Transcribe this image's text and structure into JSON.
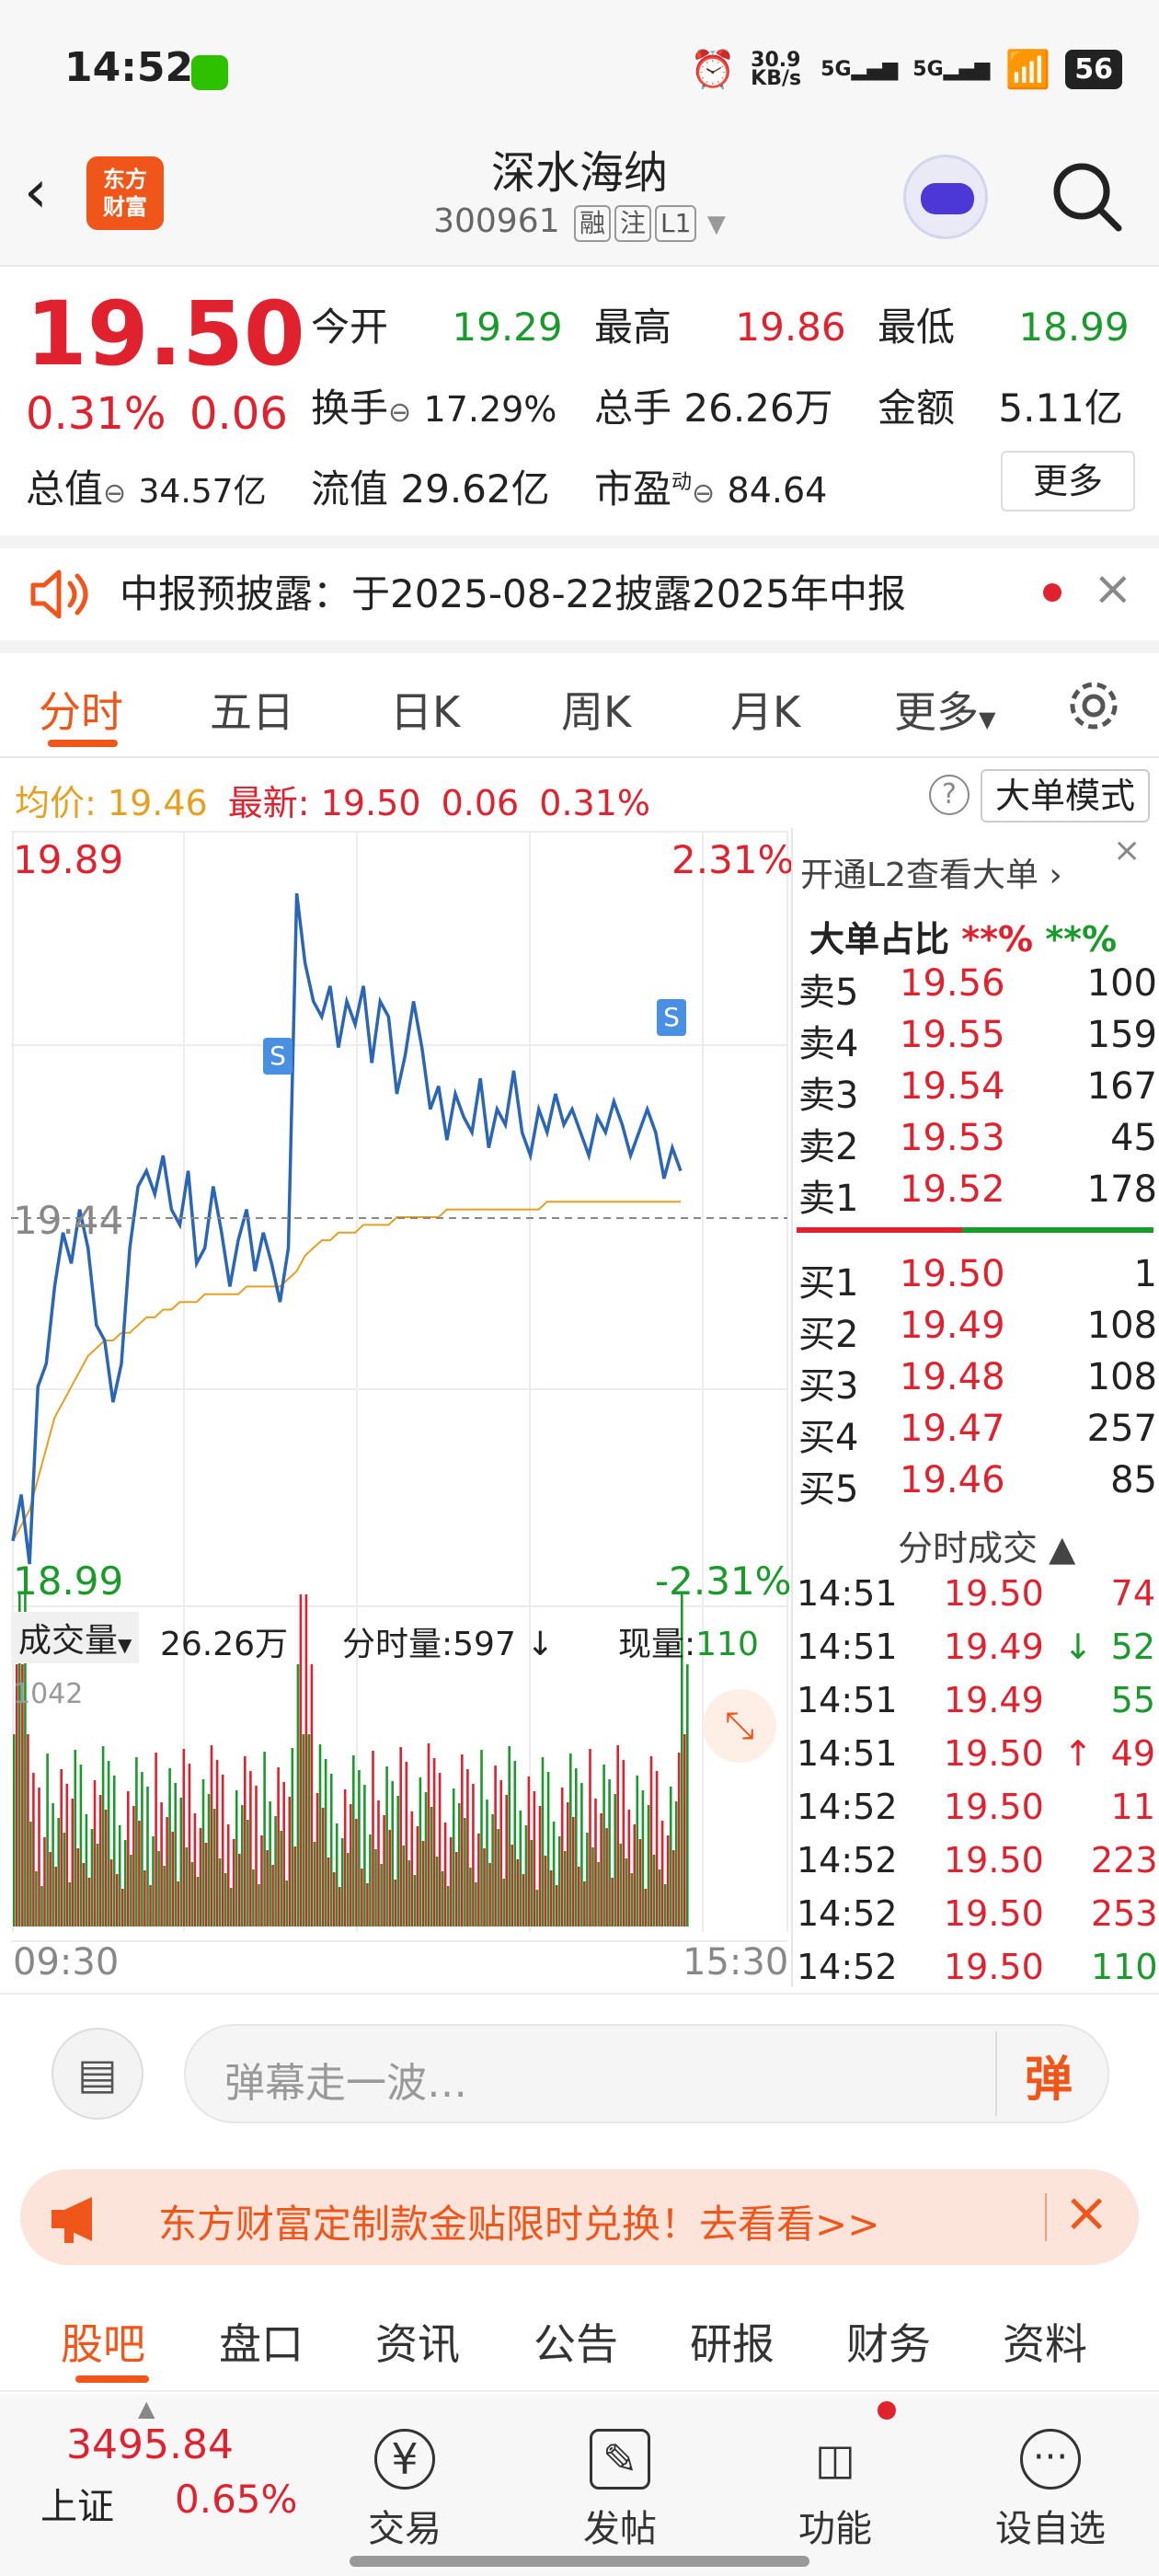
{
  "status": {
    "time": "14:52",
    "net_speed": "30.9 KB/s",
    "sig1": "5G",
    "sig2": "5G",
    "battery": "56"
  },
  "header": {
    "title": "深水海纳",
    "code": "300961",
    "tags": [
      "融",
      "注",
      "L1"
    ],
    "logo_line1": "东方",
    "logo_line2": "财富"
  },
  "quote": {
    "price": "19.50",
    "pct": "0.31%",
    "chg": "0.06",
    "open_label": "今开",
    "open": "19.29",
    "high_label": "最高",
    "high": "19.86",
    "low_label": "最低",
    "low": "18.99",
    "turnover_label": "换手",
    "turnover": "17.29%",
    "volume_label": "总手",
    "volume": "26.26万",
    "amount_label": "金额",
    "amount": "5.11亿",
    "mktcap_label": "总值",
    "mktcap": "34.57亿",
    "float_label": "流值",
    "float": "29.62亿",
    "pe_label": "市盈",
    "pe_sup": "动",
    "pe": "84.64",
    "more": "更多"
  },
  "notice": {
    "text": "中报预披露：于2025-08-22披露2025年中报"
  },
  "tabs": [
    "分时",
    "五日",
    "日K",
    "周K",
    "月K",
    "更多"
  ],
  "info": {
    "avg_label": "均价:",
    "avg": "19.46",
    "last_label": "最新:",
    "last": "19.50",
    "chg": "0.06",
    "pct": "0.31%",
    "mode": "大单模式"
  },
  "chart_data": {
    "type": "line",
    "y_top": "19.89",
    "y_bottom": "18.99",
    "y_mid": "19.44",
    "pct_top": "2.31%",
    "pct_bottom": "-2.31%",
    "x_start": "09:30",
    "x_end": "15:30",
    "ylim": [
      18.99,
      19.89
    ],
    "price": [
      19.02,
      19.08,
      18.99,
      19.22,
      19.25,
      19.35,
      19.42,
      19.38,
      19.45,
      19.4,
      19.3,
      19.28,
      19.2,
      19.25,
      19.4,
      19.48,
      19.5,
      19.47,
      19.52,
      19.45,
      19.43,
      19.5,
      19.38,
      19.4,
      19.48,
      19.42,
      19.35,
      19.41,
      19.45,
      19.37,
      19.42,
      19.38,
      19.33,
      19.4,
      19.86,
      19.77,
      19.72,
      19.7,
      19.74,
      19.66,
      19.72,
      19.69,
      19.74,
      19.64,
      19.72,
      19.7,
      19.6,
      19.65,
      19.72,
      19.66,
      19.58,
      19.61,
      19.54,
      19.6,
      19.57,
      19.55,
      19.62,
      19.53,
      19.58,
      19.56,
      19.63,
      19.55,
      19.52,
      19.58,
      19.55,
      19.6,
      19.56,
      19.58,
      19.55,
      19.52,
      19.57,
      19.55,
      19.59,
      19.56,
      19.52,
      19.55,
      19.58,
      19.55,
      19.49,
      19.53,
      19.5
    ],
    "avg": [
      19.02,
      19.04,
      19.06,
      19.1,
      19.14,
      19.18,
      19.2,
      19.22,
      19.24,
      19.26,
      19.27,
      19.28,
      19.28,
      19.29,
      19.29,
      19.3,
      19.31,
      19.31,
      19.32,
      19.32,
      19.33,
      19.33,
      19.33,
      19.34,
      19.34,
      19.34,
      19.34,
      19.34,
      19.35,
      19.35,
      19.35,
      19.35,
      19.35,
      19.36,
      19.37,
      19.39,
      19.4,
      19.41,
      19.41,
      19.42,
      19.42,
      19.42,
      19.43,
      19.43,
      19.43,
      19.43,
      19.44,
      19.44,
      19.44,
      19.44,
      19.44,
      19.44,
      19.45,
      19.45,
      19.45,
      19.45,
      19.45,
      19.45,
      19.45,
      19.45,
      19.45,
      19.45,
      19.45,
      19.45,
      19.46,
      19.46,
      19.46,
      19.46,
      19.46,
      19.46,
      19.46,
      19.46,
      19.46,
      19.46,
      19.46,
      19.46,
      19.46,
      19.46,
      19.46,
      19.46,
      19.46
    ]
  },
  "volume": {
    "label": "成交量",
    "total": "26.26万",
    "minute_label": "分时量:",
    "minute": "597",
    "current_label": "现量:",
    "current": "110",
    "max": "1042"
  },
  "orderbook": {
    "promo": "开通L2查看大单",
    "ratio_label": "大单占比",
    "ratio_red": "**%",
    "ratio_green": "**%",
    "sells": [
      {
        "l": "卖5",
        "p": "19.56",
        "v": "100"
      },
      {
        "l": "卖4",
        "p": "19.55",
        "v": "159"
      },
      {
        "l": "卖3",
        "p": "19.54",
        "v": "167"
      },
      {
        "l": "卖2",
        "p": "19.53",
        "v": "45"
      },
      {
        "l": "卖1",
        "p": "19.52",
        "v": "178"
      }
    ],
    "buys": [
      {
        "l": "买1",
        "p": "19.50",
        "v": "1"
      },
      {
        "l": "买2",
        "p": "19.49",
        "v": "108"
      },
      {
        "l": "买3",
        "p": "19.48",
        "v": "108"
      },
      {
        "l": "买4",
        "p": "19.47",
        "v": "257"
      },
      {
        "l": "买5",
        "p": "19.46",
        "v": "85"
      }
    ]
  },
  "trades": {
    "title": "分时成交",
    "rows": [
      {
        "t": "14:51",
        "p": "19.50",
        "a": "",
        "v": "74",
        "c": "red"
      },
      {
        "t": "14:51",
        "p": "19.49",
        "a": "↓",
        "v": "52",
        "c": "green"
      },
      {
        "t": "14:51",
        "p": "19.49",
        "a": "",
        "v": "55",
        "c": "green"
      },
      {
        "t": "14:51",
        "p": "19.50",
        "a": "↑",
        "v": "49",
        "c": "red"
      },
      {
        "t": "14:52",
        "p": "19.50",
        "a": "",
        "v": "11",
        "c": "red"
      },
      {
        "t": "14:52",
        "p": "19.50",
        "a": "",
        "v": "223",
        "c": "red"
      },
      {
        "t": "14:52",
        "p": "19.50",
        "a": "",
        "v": "253",
        "c": "red"
      },
      {
        "t": "14:52",
        "p": "19.50",
        "a": "",
        "v": "110",
        "c": "green"
      }
    ]
  },
  "comment": {
    "placeholder": "弹幕走一波…",
    "send": "弹"
  },
  "ad": {
    "text": "东方财富定制款金贴限时兑换！去看看>>"
  },
  "bottom_tabs": [
    "股吧",
    "盘口",
    "资讯",
    "公告",
    "研报",
    "财务",
    "资料"
  ],
  "nav": {
    "index_value": "3495.84",
    "index_name": "上证",
    "index_pct": "0.65%",
    "items": [
      "交易",
      "发帖",
      "功能",
      "设自选"
    ]
  }
}
